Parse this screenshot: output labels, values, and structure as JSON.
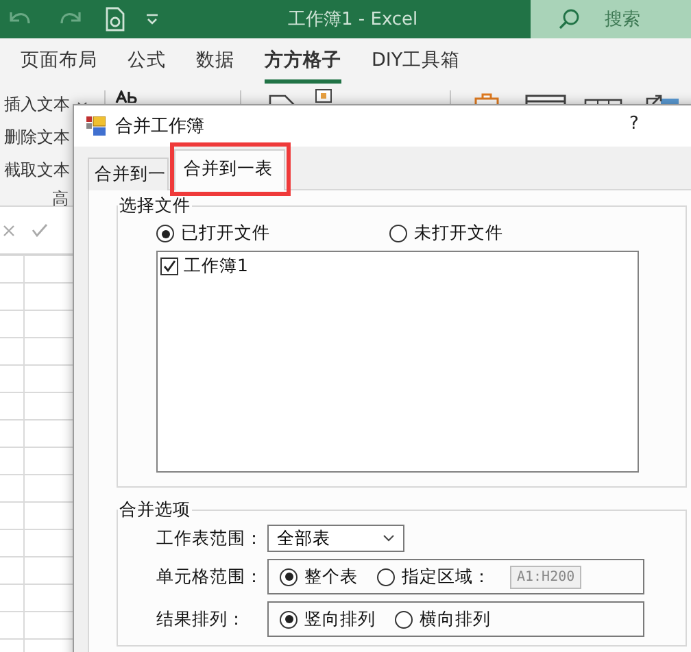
{
  "title_bar": {
    "title": "工作簿1  -  Excel",
    "search": {
      "placeholder": "搜索"
    }
  },
  "ribbon_tabs": [
    {
      "label": "页面布局",
      "selected": false
    },
    {
      "label": "公式",
      "selected": false
    },
    {
      "label": "数据",
      "selected": false
    },
    {
      "label": "方方格子",
      "selected": true
    },
    {
      "label": "DIY工具箱",
      "selected": false
    }
  ],
  "ribbon": {
    "text_commands": [
      {
        "label": "插入文本",
        "dropdown": true
      },
      {
        "label": "删除文本",
        "dropdown": false
      },
      {
        "label": "截取文本",
        "dropdown": false
      }
    ],
    "group_label": "高"
  },
  "dialog": {
    "title": "合并工作簿",
    "help": "?",
    "tabs": [
      {
        "label": "合并到一",
        "selected": false,
        "highlighted": false
      },
      {
        "label": "合并到一表",
        "selected": true,
        "highlighted": true
      }
    ],
    "file_group": {
      "title": "选择文件",
      "sources": [
        {
          "label": "已打开文件",
          "selected": true
        },
        {
          "label": "未打开文件",
          "selected": false
        }
      ],
      "files": [
        {
          "label": "工作簿1",
          "checked": true
        }
      ]
    },
    "options_group": {
      "title": "合并选项",
      "rows": [
        {
          "kind": "dropdown",
          "label": "工作表范围：",
          "value": "全部表"
        },
        {
          "kind": "radios",
          "label": "单元格范围：",
          "options": [
            {
              "label": "整个表",
              "selected": true
            },
            {
              "label": "指定区域：",
              "selected": false
            }
          ],
          "range_field": {
            "value": "A1:H200",
            "disabled": true
          }
        },
        {
          "kind": "radios",
          "label": "结果排列：",
          "options": [
            {
              "label": "竖向排列",
              "selected": true
            },
            {
              "label": "横向排列",
              "selected": false
            }
          ]
        }
      ]
    }
  }
}
